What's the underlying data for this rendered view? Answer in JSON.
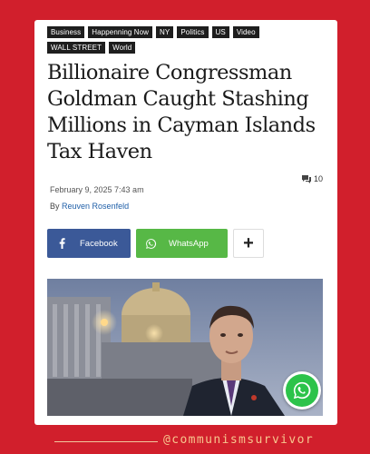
{
  "tags": [
    "Business",
    "Happenning Now",
    "NY",
    "Politics",
    "US",
    "Video",
    "WALL STREET",
    "World"
  ],
  "headline": "Billionaire Congressman Goldman Caught Stashing Millions in Cayman Islands Tax Haven",
  "comments": {
    "icon": "comment-icon",
    "count": "10"
  },
  "date": "February 9, 2025 7:43 am",
  "byline": {
    "prefix": "By",
    "author": "Reuven Rosenfeld"
  },
  "share": {
    "facebook_label": "Facebook",
    "whatsapp_label": "WhatsApp",
    "more_label": "+"
  },
  "photo": {
    "subject": "man in suit in front of Capitol dome at dusk"
  },
  "floating_button": {
    "icon": "whatsapp-icon"
  },
  "watermark": "@communismsurvivor",
  "colors": {
    "background": "#d11f2c",
    "facebook": "#3b5998",
    "whatsapp": "#57b846",
    "author_link": "#1f5fa8",
    "watermark": "#f7c68e"
  }
}
